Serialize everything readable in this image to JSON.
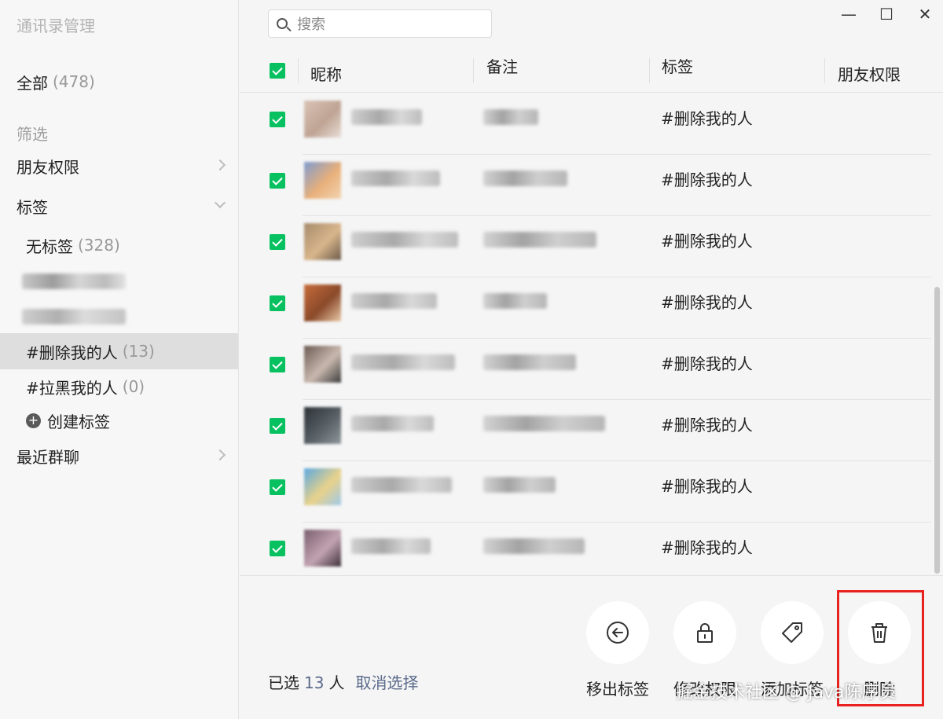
{
  "sidebar": {
    "title": "通讯录管理",
    "all": {
      "label": "全部",
      "count": "(478)"
    },
    "filter_heading": "筛选",
    "friend_permission": "朋友权限",
    "tags": "标签",
    "no_tag": {
      "label": "无标签",
      "count": "(328)"
    },
    "delete_me": {
      "label": "#删除我的人",
      "count": "(13)"
    },
    "blocked_me": {
      "label": "#拉黑我的人",
      "count": "(0)"
    },
    "create_tag": "创建标签",
    "recent_groups": "最近群聊"
  },
  "search": {
    "placeholder": "搜索"
  },
  "window_controls": {
    "minimize": "—",
    "maximize": "☐",
    "close": "✕"
  },
  "table": {
    "headers": {
      "nickname": "昵称",
      "remark": "备注",
      "tag": "标签",
      "permission": "朋友权限"
    },
    "rows": [
      {
        "tag": "#删除我的人",
        "avatar_colors": [
          "#d9c2b5",
          "#bfa494",
          "#e8ddd6"
        ]
      },
      {
        "tag": "#删除我的人",
        "avatar_colors": [
          "#7f9bd0",
          "#e8b07a",
          "#f2d3b0"
        ]
      },
      {
        "tag": "#删除我的人",
        "avatar_colors": [
          "#a58a6b",
          "#d9b68c",
          "#6b5a4a"
        ]
      },
      {
        "tag": "#删除我的人",
        "avatar_colors": [
          "#c76b3a",
          "#8a4a2a",
          "#e9c9a8"
        ]
      },
      {
        "tag": "#删除我的人",
        "avatar_colors": [
          "#6b5a52",
          "#c9b8ae",
          "#3c3c3c"
        ]
      },
      {
        "tag": "#删除我的人",
        "avatar_colors": [
          "#2c3236",
          "#596066",
          "#8f989c"
        ]
      },
      {
        "tag": "#删除我的人",
        "avatar_colors": [
          "#5aa8e0",
          "#e9d28a",
          "#9fc9ea"
        ]
      },
      {
        "tag": "#删除我的人",
        "avatar_colors": [
          "#7a5f6e",
          "#c2a3b2",
          "#3e3038"
        ]
      }
    ]
  },
  "footer": {
    "selected_prefix": "已选",
    "selected_count": "13",
    "selected_suffix": "人",
    "cancel_selection": "取消选择",
    "actions": {
      "remove_tag": "移出标签",
      "edit_permission": "修改权限",
      "add_tag": "添加标签",
      "delete": "删除"
    }
  },
  "watermark": "掘金技术社区 @ Java陈序员",
  "colors": {
    "accent_green": "#07c160",
    "highlight_red": "#e8231f",
    "link_blue": "#5b6b8c"
  }
}
